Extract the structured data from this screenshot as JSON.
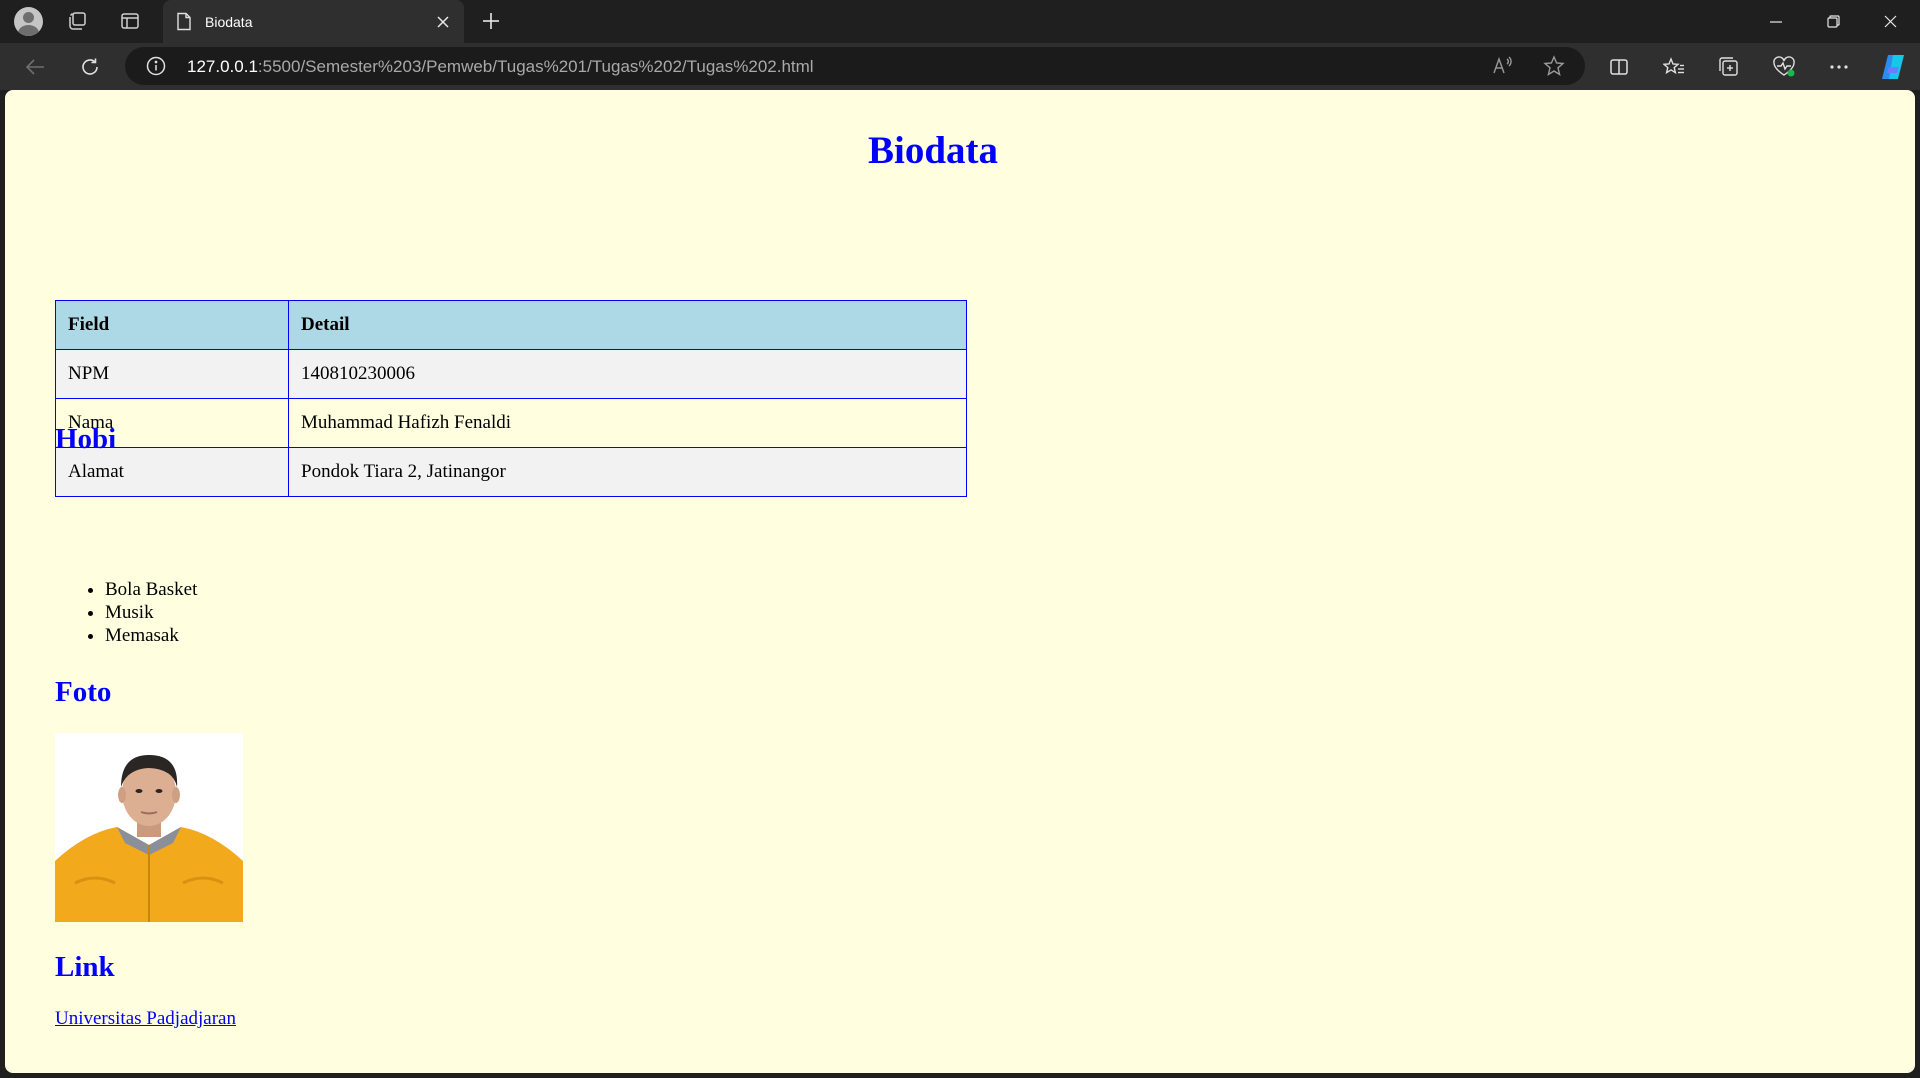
{
  "browser": {
    "tab_title": "Biodata",
    "url_host": "127.0.0.1",
    "url_rest": ":5500/Semester%203/Pemweb/Tugas%201/Tugas%202/Tugas%202.html",
    "icons": [
      "profile-icon",
      "workspaces-icon",
      "tab-actions-icon",
      "page-icon",
      "close-icon",
      "new-tab-icon",
      "minimize-icon",
      "restore-icon",
      "window-close-icon",
      "back-icon",
      "refresh-icon",
      "info-icon",
      "read-aloud-icon",
      "favorite-star-icon",
      "split-screen-icon",
      "favorites-icon",
      "collections-icon",
      "browser-essentials-icon",
      "more-icon",
      "copilot-icon"
    ]
  },
  "page": {
    "title": "Biodata",
    "table": {
      "headers": [
        "Field",
        "Detail"
      ],
      "rows": [
        [
          "NPM",
          "140810230006"
        ],
        [
          "Nama",
          "Muhammad Hafizh Fenaldi"
        ],
        [
          "Alamat",
          "Pondok Tiara 2, Jatinangor"
        ]
      ]
    },
    "hobbies_heading": "Hobi",
    "hobbies": [
      "Bola Basket",
      "Musik",
      "Memasak"
    ],
    "photo_heading": "Foto",
    "link_heading": "Link",
    "link_text": "Universitas Padjadjaran"
  },
  "colors": {
    "page_background": "#ffffe0",
    "heading": "#0000ff",
    "table_header": "#add8e6",
    "table_border": "#0000ff",
    "link": "#0000ee"
  }
}
